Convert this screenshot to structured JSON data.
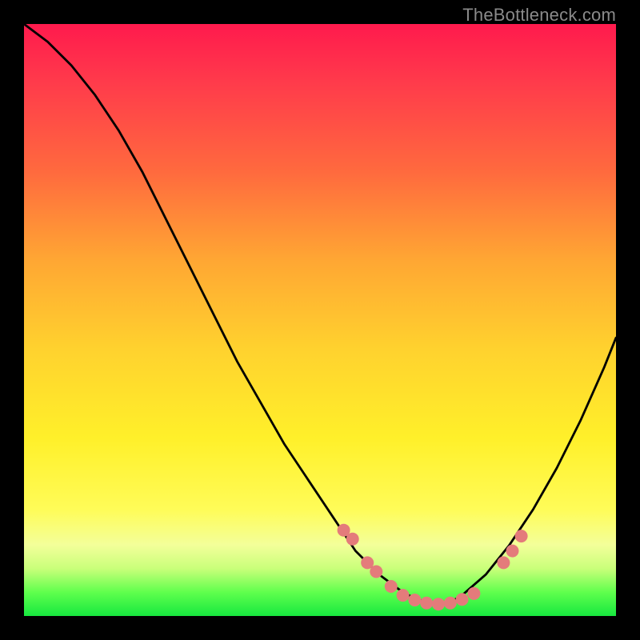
{
  "watermark": "TheBottleneck.com",
  "chart_data": {
    "type": "line",
    "title": "",
    "xlabel": "",
    "ylabel": "",
    "xlim": [
      0,
      100
    ],
    "ylim": [
      0,
      100
    ],
    "grid": false,
    "series": [
      {
        "name": "curve",
        "color": "#000000",
        "x": [
          0,
          4,
          8,
          12,
          16,
          20,
          24,
          28,
          32,
          36,
          40,
          44,
          48,
          52,
          56,
          58,
          60,
          62,
          64,
          66,
          68,
          70,
          72,
          74,
          78,
          82,
          86,
          90,
          94,
          98,
          100
        ],
        "values": [
          100,
          97,
          93,
          88,
          82,
          75,
          67,
          59,
          51,
          43,
          36,
          29,
          23,
          17,
          11,
          9,
          7,
          5.5,
          4,
          3,
          2.3,
          2,
          2.3,
          3.5,
          7,
          12,
          18,
          25,
          33,
          42,
          47
        ]
      },
      {
        "name": "markers",
        "color": "#e47b7b",
        "type": "scatter",
        "x": [
          54,
          55.5,
          58,
          59.5,
          62,
          64,
          66,
          68,
          70,
          72,
          74,
          76,
          81,
          82.5,
          84
        ],
        "values": [
          14.5,
          13,
          9,
          7.5,
          5,
          3.5,
          2.7,
          2.2,
          2,
          2.2,
          2.8,
          3.8,
          9,
          11,
          13.5
        ]
      }
    ]
  }
}
